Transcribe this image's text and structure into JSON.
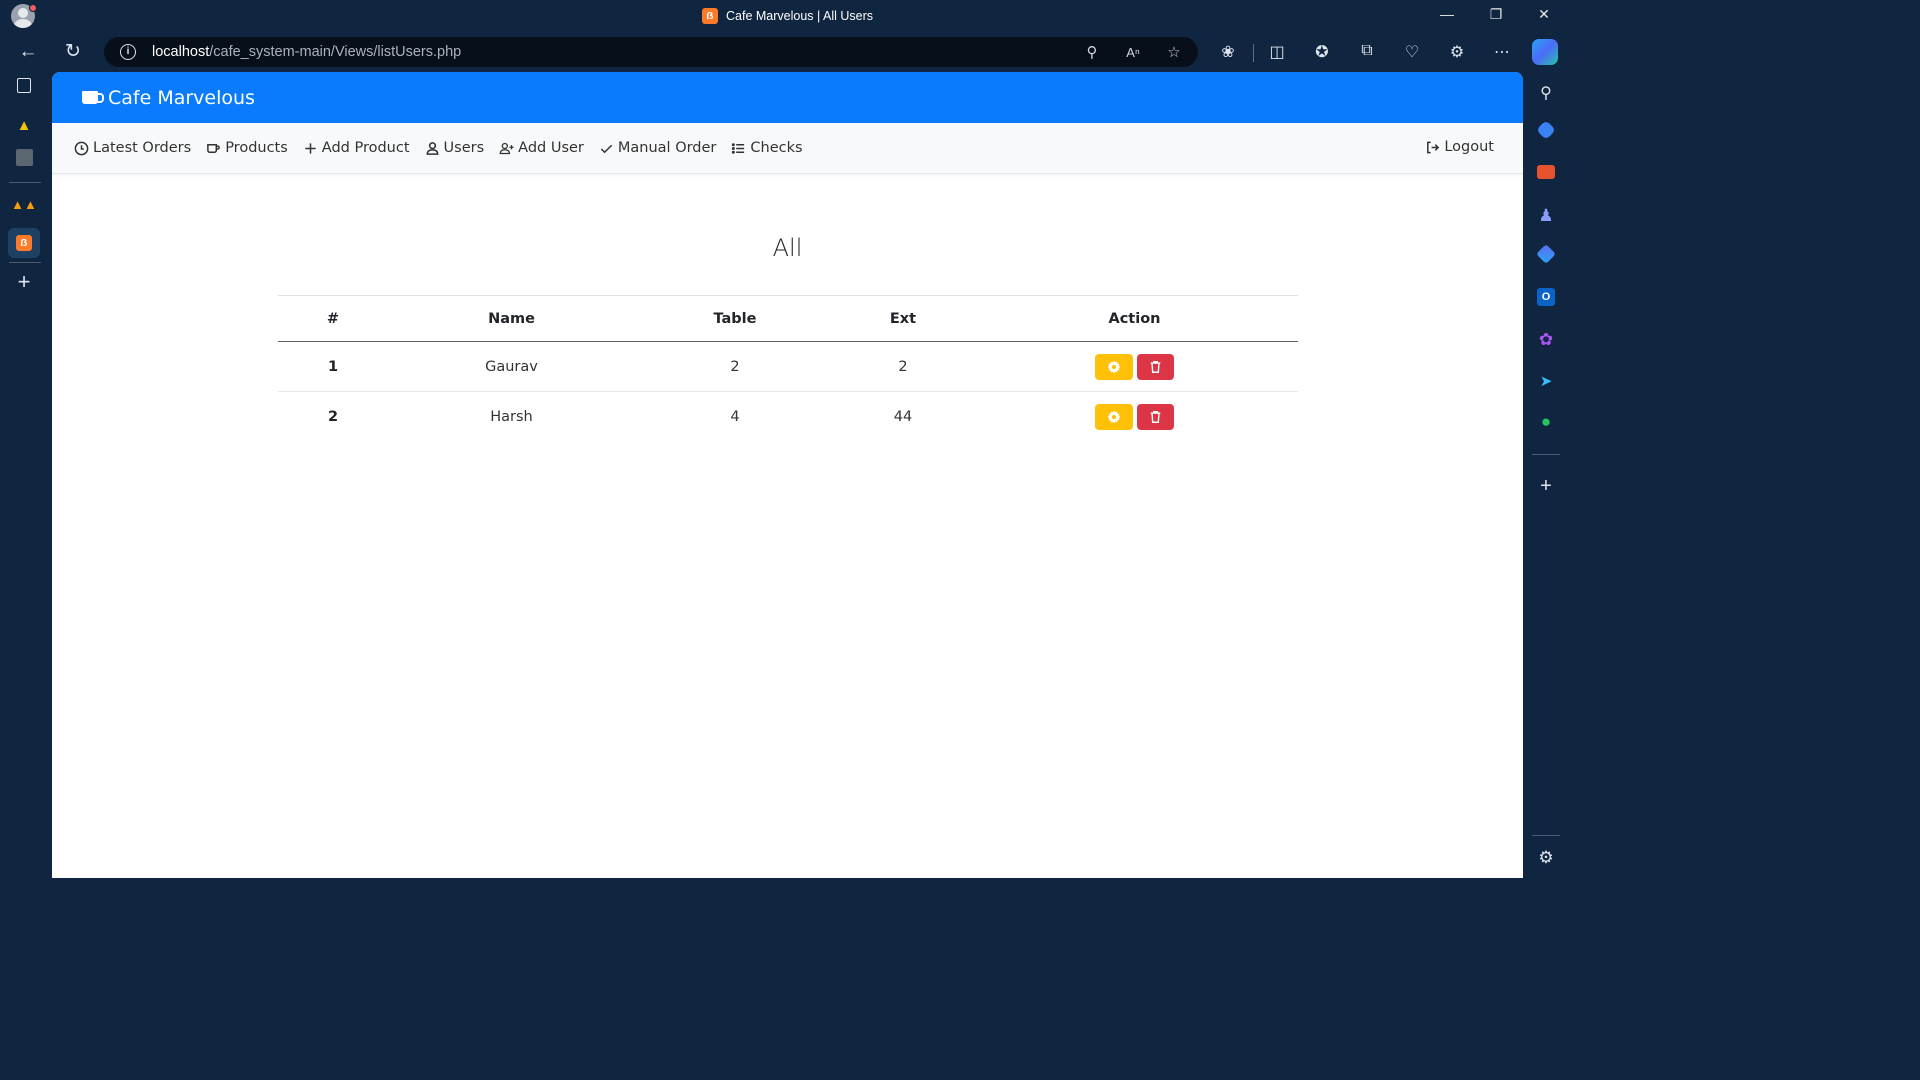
{
  "browser": {
    "tab_title": "Cafe Marvelous | All Users",
    "url_host": "localhost",
    "url_path": "/cafe_system-main/Views/listUsers.php"
  },
  "app": {
    "brand": "Cafe Marvelous",
    "brand_color": "#0a7bfc",
    "nav": [
      {
        "label": "Latest Orders",
        "icon": "clock-icon"
      },
      {
        "label": "Products",
        "icon": "cup-icon"
      },
      {
        "label": "Add Product",
        "icon": "plus-icon"
      },
      {
        "label": "Users",
        "icon": "user-icon"
      },
      {
        "label": "Add User",
        "icon": "user-plus-icon"
      },
      {
        "label": "Manual Order",
        "icon": "check-icon"
      },
      {
        "label": "Checks",
        "icon": "list-icon"
      }
    ],
    "logout": "Logout"
  },
  "page": {
    "heading": "All",
    "table": {
      "headers": [
        "#",
        "Name",
        "Table",
        "Ext",
        "Action"
      ],
      "rows": [
        {
          "id": "1",
          "name": "Gaurav",
          "table": "2",
          "ext": "2"
        },
        {
          "id": "2",
          "name": "Harsh",
          "table": "4",
          "ext": "44"
        }
      ]
    },
    "colors": {
      "edit": "#ffc107",
      "delete": "#dc3545"
    }
  }
}
